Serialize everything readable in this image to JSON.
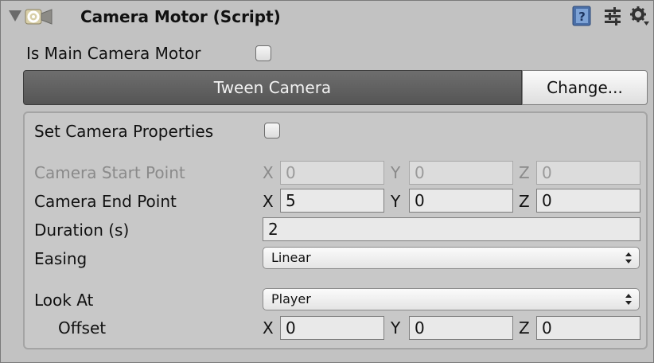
{
  "header": {
    "title": "Camera Motor (Script)",
    "icons": [
      "foldout-arrow-icon",
      "script-gear-icon",
      "help-book-icon",
      "preset-sliders-icon",
      "settings-gear-icon"
    ]
  },
  "is_main": {
    "label": "Is Main Camera Motor",
    "checked": false
  },
  "tween": {
    "label": "Tween Camera",
    "change_label": "Change..."
  },
  "props": {
    "set_label": "Set Camera Properties",
    "set_checked": false,
    "start": {
      "label": "Camera Start Point",
      "x": "0",
      "y": "0",
      "z": "0"
    },
    "end": {
      "label": "Camera End Point",
      "x": "5",
      "y": "0",
      "z": "0"
    },
    "duration": {
      "label": "Duration (s)",
      "value": "2"
    },
    "easing": {
      "label": "Easing",
      "value": "Linear"
    },
    "look_at": {
      "label": "Look At",
      "value": "Player"
    },
    "offset": {
      "label": "Offset",
      "x": "0",
      "y": "0",
      "z": "0"
    }
  },
  "axes": {
    "x": "X",
    "y": "Y",
    "z": "Z"
  },
  "colors": {
    "panel_bg": "#c2c2c2",
    "tween_bg": "#5f5f5f",
    "help_icon": "#4a6fa8"
  }
}
